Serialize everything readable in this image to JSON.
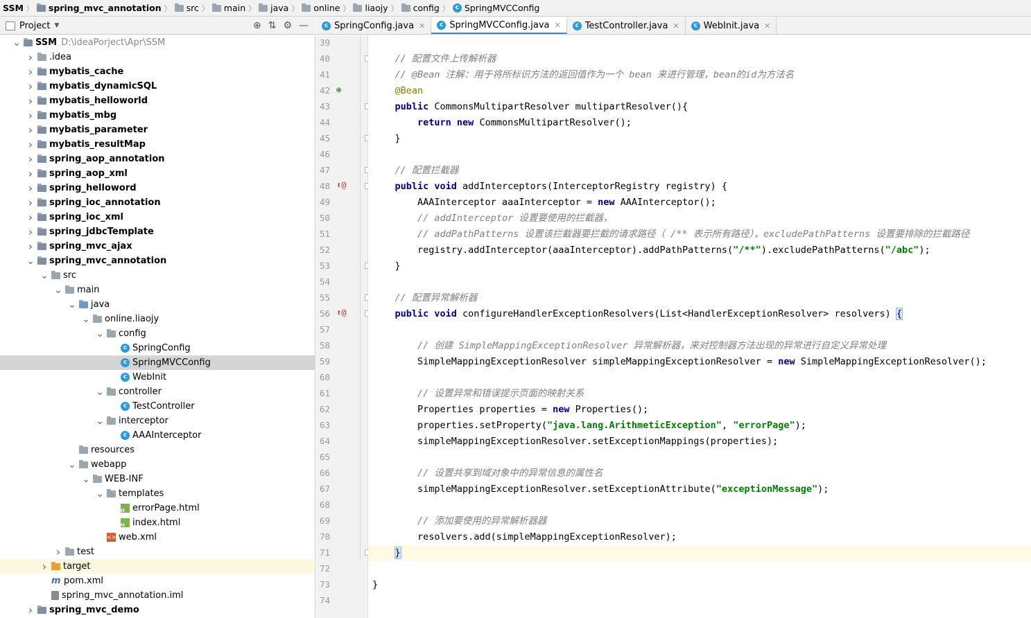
{
  "breadcrumb": [
    "SSM",
    "spring_mvc_annotation",
    "src",
    "main",
    "java",
    "online",
    "liaojy",
    "config",
    "SpringMVCConfig"
  ],
  "project_panel": {
    "title": "Project",
    "tools": [
      "⊕",
      "⇅",
      "⚙",
      "—"
    ]
  },
  "tabs": [
    {
      "label": "SpringConfig.java",
      "active": false
    },
    {
      "label": "SpringMVCConfig.java",
      "active": true
    },
    {
      "label": "TestController.java",
      "active": false
    },
    {
      "label": "WebInit.java",
      "active": false
    }
  ],
  "tree": [
    {
      "label": "SSM",
      "path": "D:\\ideaPorject\\Apr\\SSM",
      "depth": 0,
      "chev": "v",
      "icon": "module",
      "bold": true
    },
    {
      "label": ".idea",
      "depth": 1,
      "chev": ">",
      "icon": "folder"
    },
    {
      "label": "mybatis_cache",
      "depth": 1,
      "chev": ">",
      "icon": "module",
      "bold": true
    },
    {
      "label": "mybatis_dynamicSQL",
      "depth": 1,
      "chev": ">",
      "icon": "module",
      "bold": true
    },
    {
      "label": "mybatis_helloworld",
      "depth": 1,
      "chev": ">",
      "icon": "module",
      "bold": true
    },
    {
      "label": "mybatis_mbg",
      "depth": 1,
      "chev": ">",
      "icon": "module",
      "bold": true
    },
    {
      "label": "mybatis_parameter",
      "depth": 1,
      "chev": ">",
      "icon": "module",
      "bold": true
    },
    {
      "label": "mybatis_resultMap",
      "depth": 1,
      "chev": ">",
      "icon": "module",
      "bold": true
    },
    {
      "label": "spring_aop_annotation",
      "depth": 1,
      "chev": ">",
      "icon": "module",
      "bold": true
    },
    {
      "label": "spring_aop_xml",
      "depth": 1,
      "chev": ">",
      "icon": "module",
      "bold": true
    },
    {
      "label": "spring_helloword",
      "depth": 1,
      "chev": ">",
      "icon": "module",
      "bold": true
    },
    {
      "label": "spring_ioc_annotation",
      "depth": 1,
      "chev": ">",
      "icon": "module",
      "bold": true
    },
    {
      "label": "spring_ioc_xml",
      "depth": 1,
      "chev": ">",
      "icon": "module",
      "bold": true
    },
    {
      "label": "spring_jdbcTemplate",
      "depth": 1,
      "chev": ">",
      "icon": "module",
      "bold": true
    },
    {
      "label": "spring_mvc_ajax",
      "depth": 1,
      "chev": ">",
      "icon": "module",
      "bold": true
    },
    {
      "label": "spring_mvc_annotation",
      "depth": 1,
      "chev": "v",
      "icon": "module",
      "bold": true
    },
    {
      "label": "src",
      "depth": 2,
      "chev": "v",
      "icon": "folder"
    },
    {
      "label": "main",
      "depth": 3,
      "chev": "v",
      "icon": "folder"
    },
    {
      "label": "java",
      "depth": 4,
      "chev": "v",
      "icon": "folder-blue"
    },
    {
      "label": "online.liaojy",
      "depth": 5,
      "chev": "v",
      "icon": "package"
    },
    {
      "label": "config",
      "depth": 6,
      "chev": "v",
      "icon": "package"
    },
    {
      "label": "SpringConfig",
      "depth": 7,
      "chev": "",
      "icon": "class"
    },
    {
      "label": "SpringMVCConfig",
      "depth": 7,
      "chev": "",
      "icon": "class",
      "selected": true
    },
    {
      "label": "WebInit",
      "depth": 7,
      "chev": "",
      "icon": "class"
    },
    {
      "label": "controller",
      "depth": 6,
      "chev": "v",
      "icon": "package"
    },
    {
      "label": "TestController",
      "depth": 7,
      "chev": "",
      "icon": "class"
    },
    {
      "label": "interceptor",
      "depth": 6,
      "chev": "v",
      "icon": "package"
    },
    {
      "label": "AAAInterceptor",
      "depth": 7,
      "chev": "",
      "icon": "class"
    },
    {
      "label": "resources",
      "depth": 4,
      "chev": "",
      "icon": "folder-res"
    },
    {
      "label": "webapp",
      "depth": 4,
      "chev": "v",
      "icon": "folder-web"
    },
    {
      "label": "WEB-INF",
      "depth": 5,
      "chev": "v",
      "icon": "folder"
    },
    {
      "label": "templates",
      "depth": 6,
      "chev": "v",
      "icon": "folder"
    },
    {
      "label": "errorPage.html",
      "depth": 7,
      "chev": "",
      "icon": "html"
    },
    {
      "label": "index.html",
      "depth": 7,
      "chev": "",
      "icon": "html"
    },
    {
      "label": "web.xml",
      "depth": 6,
      "chev": "",
      "icon": "xml"
    },
    {
      "label": "test",
      "depth": 3,
      "chev": ">",
      "icon": "folder"
    },
    {
      "label": "target",
      "depth": 2,
      "chev": ">",
      "icon": "folder-orange",
      "highlight": true
    },
    {
      "label": "pom.xml",
      "depth": 2,
      "chev": "",
      "icon": "pom"
    },
    {
      "label": "spring_mvc_annotation.iml",
      "depth": 2,
      "chev": "",
      "icon": "iml"
    },
    {
      "label": "spring_mvc_demo",
      "depth": 1,
      "chev": ">",
      "icon": "module",
      "bold": true
    }
  ],
  "code": [
    {
      "n": "39",
      "seg": []
    },
    {
      "n": "40",
      "fold": true,
      "seg": [
        [
          "pl",
          "    "
        ],
        [
          "cm",
          "// 配置文件上传解析器"
        ]
      ]
    },
    {
      "n": "41",
      "seg": [
        [
          "pl",
          "    "
        ],
        [
          "cm",
          "// @Bean 注解：用于将所标识方法的返回值作为一个 bean 来进行管理，bean的id为方法名"
        ]
      ]
    },
    {
      "n": "42",
      "mark": "bean",
      "seg": [
        [
          "pl",
          "    "
        ],
        [
          "an",
          "@Bean"
        ]
      ]
    },
    {
      "n": "43",
      "fold": true,
      "seg": [
        [
          "pl",
          "    "
        ],
        [
          "kw",
          "public"
        ],
        [
          "pl",
          " CommonsMultipartResolver multipartResolver(){"
        ]
      ]
    },
    {
      "n": "44",
      "seg": [
        [
          "pl",
          "        "
        ],
        [
          "kw",
          "return new"
        ],
        [
          "pl",
          " CommonsMultipartResolver();"
        ]
      ]
    },
    {
      "n": "45",
      "fold": true,
      "seg": [
        [
          "pl",
          "    }"
        ]
      ]
    },
    {
      "n": "46",
      "seg": []
    },
    {
      "n": "47",
      "fold": true,
      "seg": [
        [
          "pl",
          "    "
        ],
        [
          "cm",
          "// 配置拦截器"
        ]
      ]
    },
    {
      "n": "48",
      "mark": "override",
      "fold": true,
      "seg": [
        [
          "pl",
          "    "
        ],
        [
          "kw",
          "public void"
        ],
        [
          "pl",
          " addInterceptors(InterceptorRegistry registry) {"
        ]
      ]
    },
    {
      "n": "49",
      "seg": [
        [
          "pl",
          "        AAAInterceptor aaaInterceptor = "
        ],
        [
          "kw",
          "new"
        ],
        [
          "pl",
          " AAAInterceptor();"
        ]
      ]
    },
    {
      "n": "50",
      "seg": [
        [
          "pl",
          "        "
        ],
        [
          "cm",
          "// addInterceptor 设置要使用的拦截器，"
        ]
      ]
    },
    {
      "n": "51",
      "seg": [
        [
          "pl",
          "        "
        ],
        [
          "cm",
          "// addPathPatterns 设置该拦截器要拦截的请求路径（ /** 表示所有路径），excludePathPatterns 设置要排除的拦截路径"
        ]
      ]
    },
    {
      "n": "52",
      "seg": [
        [
          "pl",
          "        registry.addInterceptor(aaaInterceptor).addPathPatterns("
        ],
        [
          "st",
          "\"/**\""
        ],
        [
          "pl",
          ").excludePathPatterns("
        ],
        [
          "st",
          "\"/abc\""
        ],
        [
          "pl",
          ");"
        ]
      ]
    },
    {
      "n": "53",
      "fold": true,
      "seg": [
        [
          "pl",
          "    }"
        ]
      ]
    },
    {
      "n": "54",
      "seg": []
    },
    {
      "n": "55",
      "fold": true,
      "seg": [
        [
          "pl",
          "    "
        ],
        [
          "cm",
          "// 配置异常解析器"
        ]
      ]
    },
    {
      "n": "56",
      "mark": "override",
      "fold": true,
      "seg": [
        [
          "pl",
          "    "
        ],
        [
          "kw",
          "public void"
        ],
        [
          "pl",
          " configureHandlerExceptionResolvers(List<HandlerExceptionResolver> resolvers) "
        ],
        [
          "br",
          "{"
        ]
      ]
    },
    {
      "n": "57",
      "seg": []
    },
    {
      "n": "58",
      "seg": [
        [
          "pl",
          "        "
        ],
        [
          "cm",
          "// 创建 SimpleMappingExceptionResolver 异常解析器，来对控制器方法出现的异常进行自定义异常处理"
        ]
      ]
    },
    {
      "n": "59",
      "seg": [
        [
          "pl",
          "        SimpleMappingExceptionResolver simpleMappingExceptionResolver = "
        ],
        [
          "kw",
          "new"
        ],
        [
          "pl",
          " SimpleMappingExceptionResolver();"
        ]
      ]
    },
    {
      "n": "60",
      "seg": []
    },
    {
      "n": "61",
      "seg": [
        [
          "pl",
          "        "
        ],
        [
          "cm",
          "// 设置异常和错误提示页面的映射关系"
        ]
      ]
    },
    {
      "n": "62",
      "seg": [
        [
          "pl",
          "        Properties properties = "
        ],
        [
          "kw",
          "new"
        ],
        [
          "pl",
          " Properties();"
        ]
      ]
    },
    {
      "n": "63",
      "seg": [
        [
          "pl",
          "        properties.setProperty("
        ],
        [
          "st",
          "\"java.lang.ArithmeticException\""
        ],
        [
          "pl",
          ", "
        ],
        [
          "st",
          "\"errorPage\""
        ],
        [
          "pl",
          ");"
        ]
      ]
    },
    {
      "n": "64",
      "seg": [
        [
          "pl",
          "        simpleMappingExceptionResolver.setExceptionMappings(properties);"
        ]
      ]
    },
    {
      "n": "65",
      "seg": []
    },
    {
      "n": "66",
      "seg": [
        [
          "pl",
          "        "
        ],
        [
          "cm",
          "// 设置共享到域对象中的异常信息的属性名"
        ]
      ]
    },
    {
      "n": "67",
      "seg": [
        [
          "pl",
          "        simpleMappingExceptionResolver.setExceptionAttribute("
        ],
        [
          "st",
          "\"exceptionMessage\""
        ],
        [
          "pl",
          ");"
        ]
      ]
    },
    {
      "n": "68",
      "seg": []
    },
    {
      "n": "69",
      "seg": [
        [
          "pl",
          "        "
        ],
        [
          "cm",
          "// 添加要使用的异常解析器器"
        ]
      ]
    },
    {
      "n": "70",
      "seg": [
        [
          "pl",
          "        resolvers.add(simpleMappingExceptionResolver);"
        ]
      ]
    },
    {
      "n": "71",
      "fold": true,
      "current": true,
      "seg": [
        [
          "pl",
          "    "
        ],
        [
          "br",
          "}"
        ]
      ]
    },
    {
      "n": "72",
      "seg": []
    },
    {
      "n": "73",
      "seg": [
        [
          "pl",
          "}"
        ]
      ]
    },
    {
      "n": "74",
      "seg": []
    }
  ]
}
